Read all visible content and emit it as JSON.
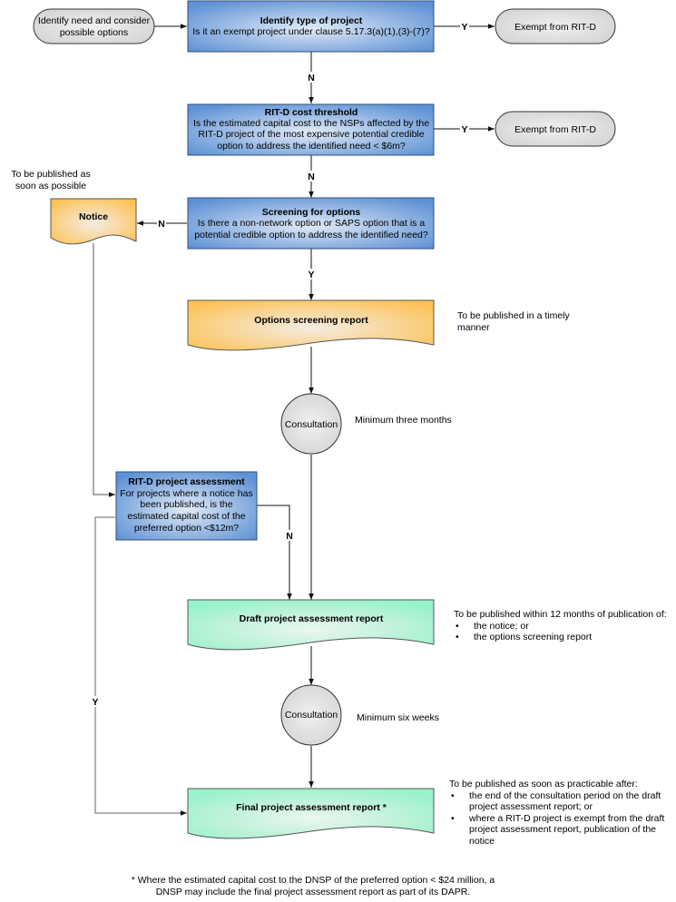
{
  "nodes": {
    "start": {
      "label_lines": [
        "Identify need and consider",
        "possible options"
      ]
    },
    "identify_type": {
      "title": "Identify type of project",
      "question_lines": [
        "Is it an exempt project under clause 5.17.3(a)(1),(3)-(7)?"
      ]
    },
    "exempt_1": {
      "label": "Exempt from RIT-D"
    },
    "cost_threshold": {
      "title": "RIT-D cost threshold",
      "question_lines": [
        "Is the estimated capital cost to the NSPs affected by the",
        "RIT-D project of the most expensive potential credible",
        "option to address the identified need < $6m?"
      ]
    },
    "exempt_2": {
      "label": "Exempt from RIT-D"
    },
    "screening": {
      "title": "Screening for options",
      "question_lines": [
        "Is there a non-network option or SAPS option that is a",
        "potential credible option to address the identified need?"
      ]
    },
    "notice": {
      "label": "Notice"
    },
    "options_report": {
      "label": "Options screening report"
    },
    "consultation_1": {
      "label": "Consultation"
    },
    "project_assessment": {
      "title": "RIT-D project assessment",
      "question_lines": [
        "For projects where a notice has",
        "been published, is the",
        "estimated capital cost of the",
        "preferred option <$12m?"
      ]
    },
    "draft_report": {
      "label": "Draft project assessment report"
    },
    "consultation_2": {
      "label": "Consultation"
    },
    "final_report": {
      "label": "Final project assessment report *"
    }
  },
  "edge_labels": {
    "identify_to_exempt": "Y",
    "identify_to_cost": "N",
    "cost_to_exempt": "Y",
    "cost_to_screening": "N",
    "screening_to_notice": "N",
    "screening_to_options": "Y",
    "assessment_to_draft": "N",
    "assessment_to_final": "Y"
  },
  "notes": {
    "notice_timing": "To be published as soon as possible",
    "options_timing": "To be published in a timely manner",
    "consultation_1_duration": "Minimum three months",
    "draft_timing": {
      "intro": "To be published within 12 months of publication of:",
      "bullets": [
        "the notice; or",
        "the options screening report"
      ]
    },
    "consultation_2_duration": "Minimum six weeks",
    "final_timing": {
      "intro": "To be published as soon as practicable after:",
      "bullets": [
        "the end of the consultation period on the draft project assessment report; or",
        "where a RIT-D project is exempt from the draft project assessment report, publication of the notice"
      ]
    },
    "footnote": "* Where the  estimated capital cost to the DNSP of the preferred option < $24 million, a DNSP may include the final project assessment report as part of its DAPR."
  },
  "colors": {
    "decision_blue": "#6a9bd8",
    "decision_highlight": "#dfe9f7",
    "report_orange": "#fcc55c",
    "report_highlight": "#f5ecdc",
    "report_green": "#9ff3cf",
    "report_green_highlight": "#eaf7f1",
    "terminator_gray": "#d9d9d9",
    "stroke": "#3a3a3a"
  }
}
